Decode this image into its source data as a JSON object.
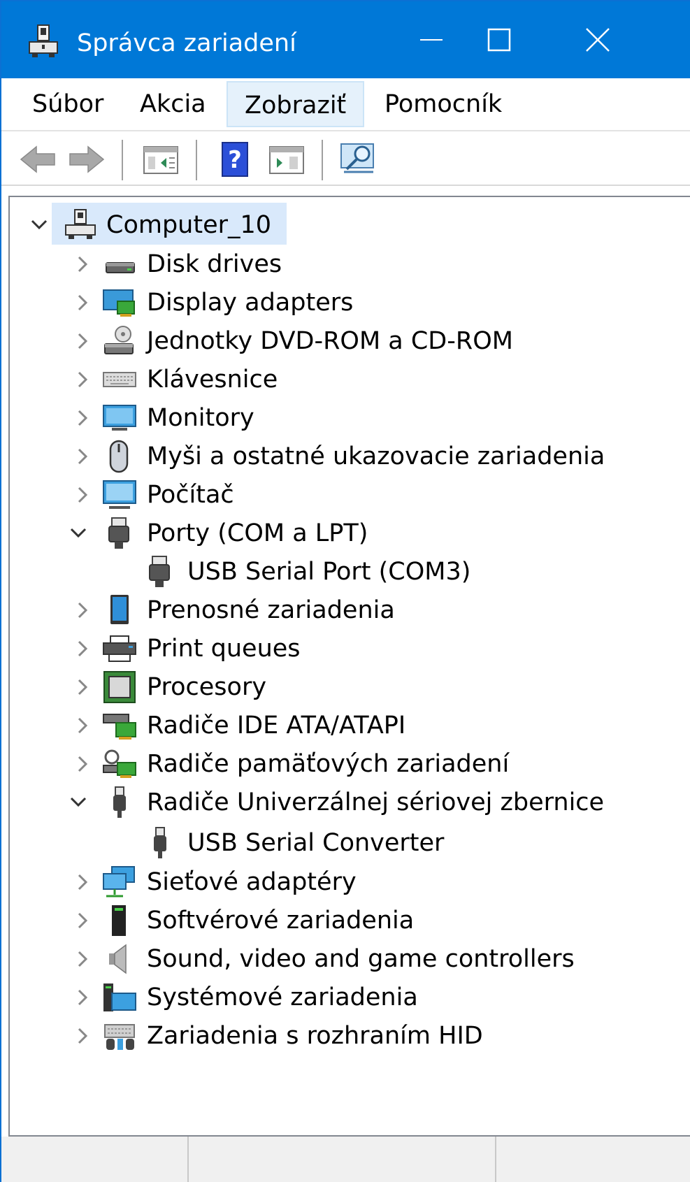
{
  "window": {
    "title": "Správca zariadení",
    "accent_color": "#0078d7"
  },
  "titlebar_buttons": [
    {
      "name": "minimize",
      "icon": "minimize-icon"
    },
    {
      "name": "maximize",
      "icon": "maximize-icon"
    },
    {
      "name": "close",
      "icon": "close-icon"
    }
  ],
  "menu": {
    "items": [
      {
        "label": "Súbor"
      },
      {
        "label": "Akcia"
      },
      {
        "label": "Zobraziť",
        "active": true
      },
      {
        "label": "Pomocník"
      }
    ]
  },
  "toolbar": {
    "buttons": [
      {
        "name": "back",
        "icon": "arrow-left-icon"
      },
      {
        "name": "forward",
        "icon": "arrow-right-icon"
      },
      {
        "name": "show-hide-console-tree",
        "icon": "console-tree-icon"
      },
      {
        "name": "help",
        "icon": "help-icon"
      },
      {
        "name": "show-hide-action-pane",
        "icon": "action-pane-icon"
      },
      {
        "name": "scan-hardware",
        "icon": "scan-hardware-icon"
      }
    ]
  },
  "tree": {
    "root": {
      "label": "Computer_10",
      "icon": "computer-icon",
      "expanded": true,
      "selected": true
    },
    "items": [
      {
        "label": "Disk drives",
        "icon": "disk-drive-icon",
        "expanded": false
      },
      {
        "label": "Display adapters",
        "icon": "display-adapter-icon",
        "expanded": false
      },
      {
        "label": "Jednotky DVD-ROM a CD-ROM",
        "icon": "dvd-drive-icon",
        "expanded": false
      },
      {
        "label": "Klávesnice",
        "icon": "keyboard-icon",
        "expanded": false
      },
      {
        "label": "Monitory",
        "icon": "monitor-icon",
        "expanded": false
      },
      {
        "label": "Myši a ostatné ukazovacie zariadenia",
        "icon": "mouse-icon",
        "expanded": false
      },
      {
        "label": "Počítač",
        "icon": "pc-icon",
        "expanded": false
      },
      {
        "label": "Porty (COM a LPT)",
        "icon": "port-icon",
        "expanded": true,
        "children": [
          {
            "label": "USB Serial Port (COM3)",
            "icon": "port-icon"
          }
        ]
      },
      {
        "label": "Prenosné zariadenia",
        "icon": "portable-device-icon",
        "expanded": false
      },
      {
        "label": "Print queues",
        "icon": "printer-icon",
        "expanded": false
      },
      {
        "label": "Procesory",
        "icon": "processor-icon",
        "expanded": false
      },
      {
        "label": "Radiče IDE ATA/ATAPI",
        "icon": "ide-controller-icon",
        "expanded": false
      },
      {
        "label": "Radiče pamäťových zariadení",
        "icon": "storage-controller-icon",
        "expanded": false
      },
      {
        "label": "Radiče Univerzálnej sériovej zbernice",
        "icon": "usb-icon",
        "expanded": true,
        "children": [
          {
            "label": "USB Serial Converter",
            "icon": "usb-icon"
          }
        ]
      },
      {
        "label": "Sieťové adaptéry",
        "icon": "network-adapter-icon",
        "expanded": false
      },
      {
        "label": "Softvérové zariadenia",
        "icon": "software-device-icon",
        "expanded": false
      },
      {
        "label": "Sound, video and game controllers",
        "icon": "speaker-icon",
        "expanded": false
      },
      {
        "label": "Systémové zariadenia",
        "icon": "system-device-icon",
        "expanded": false
      },
      {
        "label": "Zariadenia s rozhraním HID",
        "icon": "hid-icon",
        "expanded": false
      }
    ]
  },
  "statusbar": {
    "cells": [
      "",
      "",
      ""
    ]
  }
}
